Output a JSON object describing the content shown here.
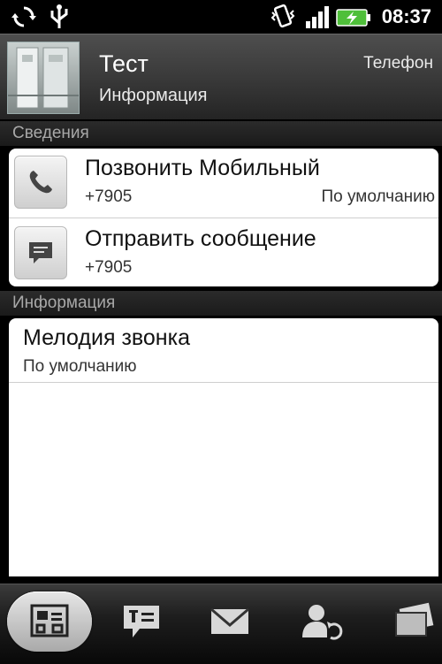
{
  "status_bar": {
    "time": "08:37",
    "icons": [
      "sync-icon",
      "usb-icon",
      "vibrate-icon",
      "signal-icon",
      "battery-charging-icon"
    ]
  },
  "contact": {
    "name": "Тест",
    "subtitle": "Информация",
    "type_label": "Телефон",
    "avatar_icon": "contact-photo"
  },
  "sections": {
    "details_header": "Сведения",
    "info_header": "Информация"
  },
  "actions": [
    {
      "icon": "phone-icon",
      "title": "Позвонить Мобильный",
      "number": "+7905",
      "note": "По умолчанию"
    },
    {
      "icon": "message-icon",
      "title": "Отправить сообщение",
      "number": "+7905"
    }
  ],
  "info": {
    "ringtone_label": "Мелодия звонка",
    "ringtone_value": "По умолчанию"
  },
  "tabs": [
    {
      "icon": "contact-details-icon",
      "active": true
    },
    {
      "icon": "messages-icon",
      "active": false
    },
    {
      "icon": "mail-icon",
      "active": false
    },
    {
      "icon": "contact-sync-icon",
      "active": false
    },
    {
      "icon": "gallery-icon",
      "active": false
    }
  ],
  "colors": {
    "background": "#000000",
    "card": "#ffffff",
    "battery": "#4fbf3a"
  }
}
